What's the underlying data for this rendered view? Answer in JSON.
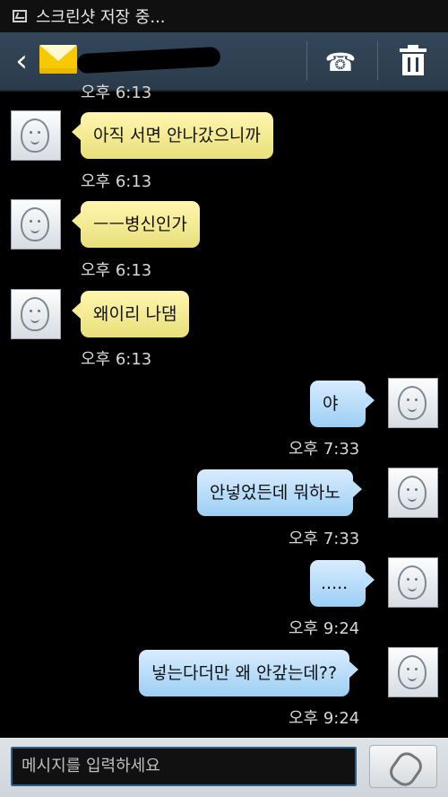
{
  "status": {
    "text": "스크린샷 저장 중..."
  },
  "header": {
    "back_icon": "‹",
    "phone_icon": "☎"
  },
  "messages": {
    "cutoff_time": "오후 6:13",
    "m1": {
      "text": "아직 서면 안나갔으니까",
      "time": "오후 6:13"
    },
    "m2": {
      "text": "ㅡㅡ병신인가",
      "time": "오후 6:13"
    },
    "m3": {
      "text": "왜이리 나댐",
      "time": "오후 6:13"
    },
    "m4": {
      "text": "야",
      "time": "오후 7:33"
    },
    "m5": {
      "text": "안넣었든데 뭐하노",
      "time": "오후 7:33"
    },
    "m6": {
      "text": ".....",
      "time": "오후 9:24"
    },
    "m7": {
      "text": "넣는다더만 왜 안갚는데??",
      "time": "오후 9:24"
    }
  },
  "composer": {
    "placeholder": "메시지를 입력하세요"
  },
  "colors": {
    "topbar": "#2b3b4b",
    "incoming_bubble": "#f6ec96",
    "outgoing_bubble": "#bfe0fb",
    "background": "#000000"
  }
}
